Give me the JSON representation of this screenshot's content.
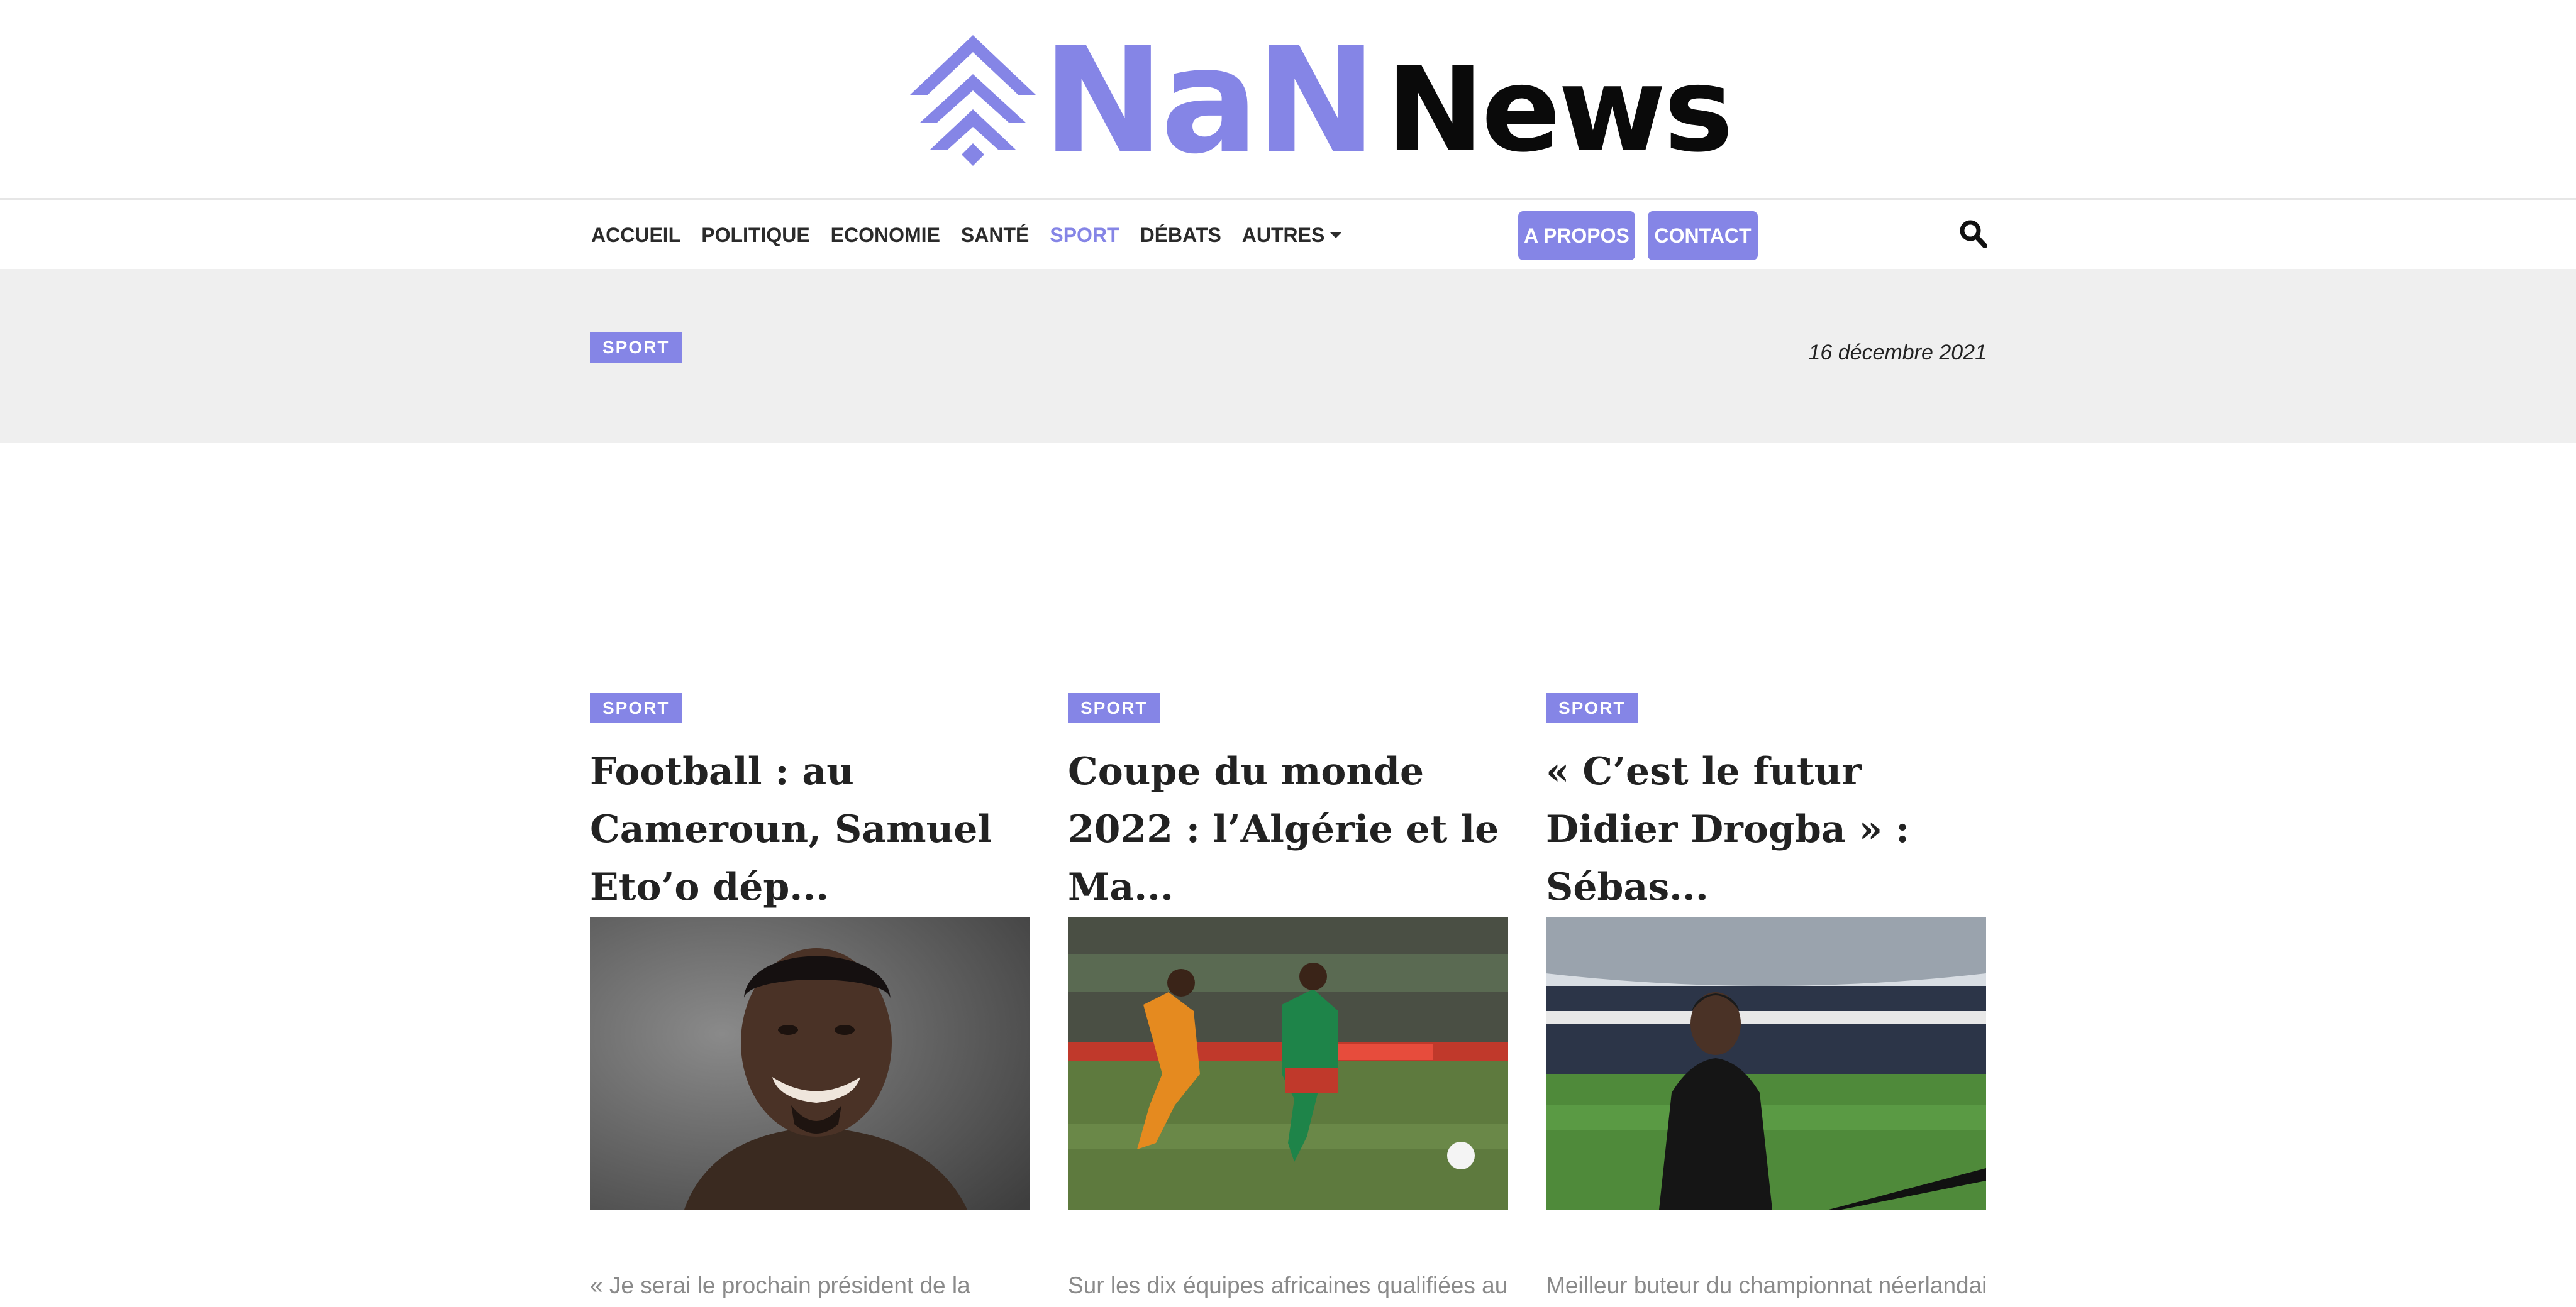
{
  "site": {
    "logo_part1": "NaN",
    "logo_part2": "News",
    "accent_color": "#8585e6"
  },
  "nav": {
    "items": [
      {
        "label": "ACCUEIL",
        "active": false
      },
      {
        "label": "POLITIQUE",
        "active": false
      },
      {
        "label": "ECONOMIE",
        "active": false
      },
      {
        "label": "SANTÉ",
        "active": false
      },
      {
        "label": "SPORT",
        "active": true
      },
      {
        "label": "DÉBATS",
        "active": false
      },
      {
        "label": "AUTRES",
        "active": false,
        "dropdown": true
      }
    ],
    "about_label": "A PROPOS",
    "contact_label": "CONTACT",
    "search_icon": "search-icon"
  },
  "banner": {
    "category": "SPORT",
    "date": "16 décembre 2021"
  },
  "articles": [
    {
      "category": "SPORT",
      "title": "Football : au Cameroun, Samuel Eto’o dép...",
      "image": "portrait of smiling man against gray background",
      "excerpt": "« Je serai le prochain président de la"
    },
    {
      "category": "SPORT",
      "title": "Coupe du monde 2022 : l’Algérie et le Ma...",
      "image": "two football players chasing a ball on the pitch",
      "excerpt": "Sur les dix équipes africaines qualifiées au"
    },
    {
      "category": "SPORT",
      "title": "« C’est le futur Didier Drogba » : Sébas...",
      "image": "man in black coat standing in a stadium",
      "excerpt": "Meilleur buteur du championnat néerlandais,"
    }
  ]
}
